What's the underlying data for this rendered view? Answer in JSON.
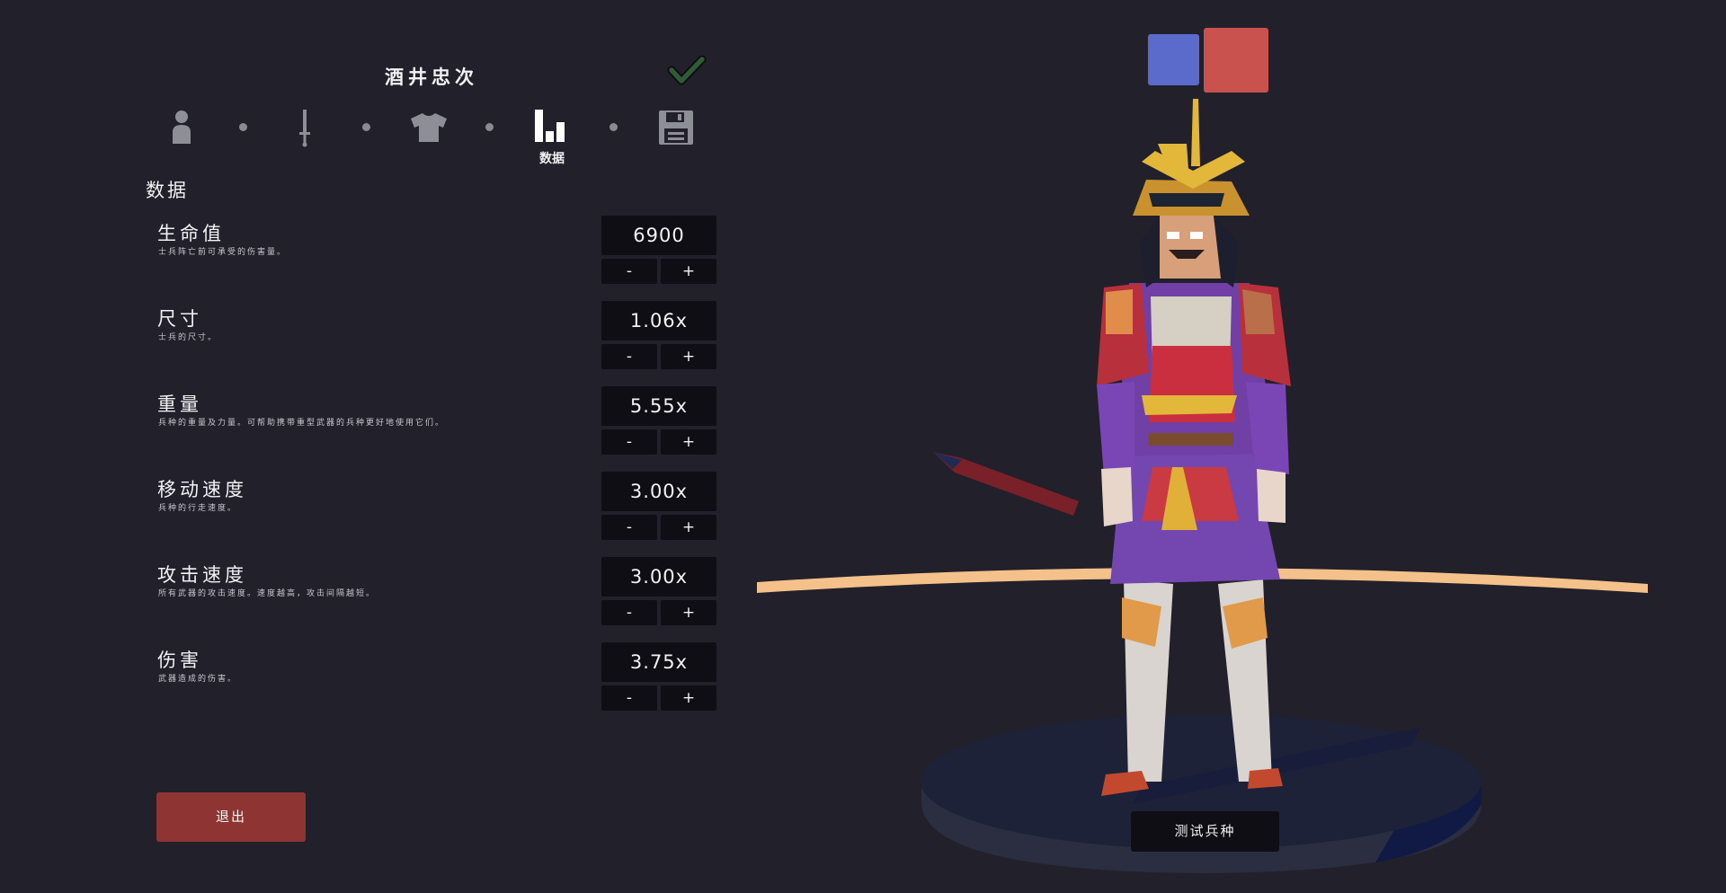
{
  "unit": {
    "name": "酒井忠次"
  },
  "steps": [
    {
      "icon": "person-icon"
    },
    {
      "icon": "sword-icon"
    },
    {
      "icon": "shirt-icon"
    },
    {
      "icon": "bar-chart-icon",
      "label": "数据"
    },
    {
      "icon": "floppy-disk-icon"
    }
  ],
  "section_title": "数据",
  "stats": [
    {
      "name": "生命值",
      "desc": "士兵阵亡前可承受的伤害量。",
      "value": "6900"
    },
    {
      "name": "尺寸",
      "desc": "士兵的尺寸。",
      "value": "1.06x"
    },
    {
      "name": "重量",
      "desc": "兵种的重量及力量。可帮助携带重型武器的兵种更好地使用它们。",
      "value": "5.55x"
    },
    {
      "name": "移动速度",
      "desc": "兵种的行走速度。",
      "value": "3.00x"
    },
    {
      "name": "攻击速度",
      "desc": "所有武器的攻击速度。速度越高，攻击间隔越短。",
      "value": "3.00x"
    },
    {
      "name": "伤害",
      "desc": "武器造成的伤害。",
      "value": "3.75x"
    }
  ],
  "buttons": {
    "minus": "-",
    "plus": "+",
    "exit": "退出",
    "test_unit": "测试兵种"
  },
  "colors": {
    "team_blue": "#5a6bcc",
    "team_red": "#c9524f",
    "exit": "#8e3534",
    "check": "#2f5b36"
  }
}
